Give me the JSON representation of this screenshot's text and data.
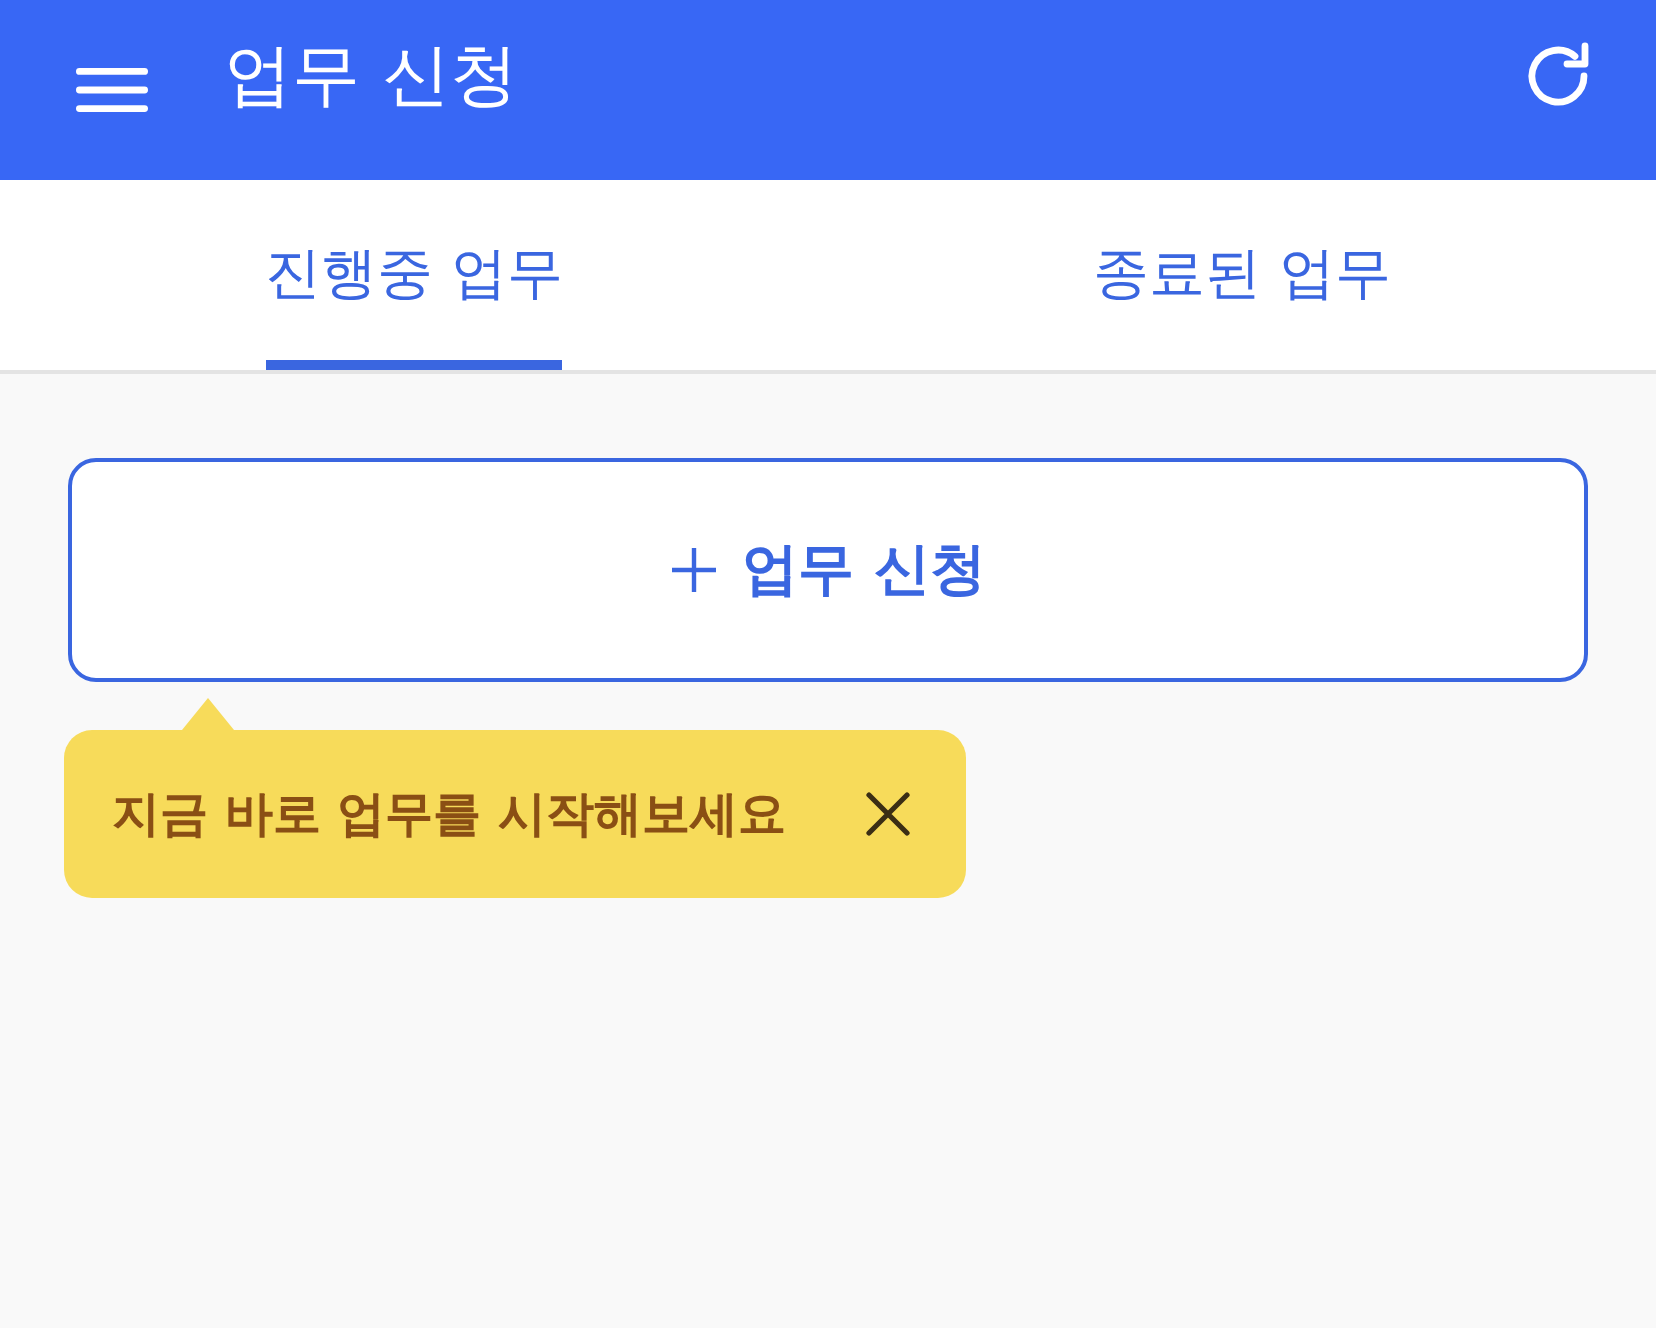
{
  "app_bar": {
    "title": "업무 신청"
  },
  "tabs": [
    {
      "label": "진행중 업무",
      "selected": true
    },
    {
      "label": "종료된 업무",
      "selected": false
    }
  ],
  "new_request_button": {
    "label": "업무 신청"
  },
  "tooltip": {
    "text": "지금 바로 업무를 시작해보세요"
  }
}
